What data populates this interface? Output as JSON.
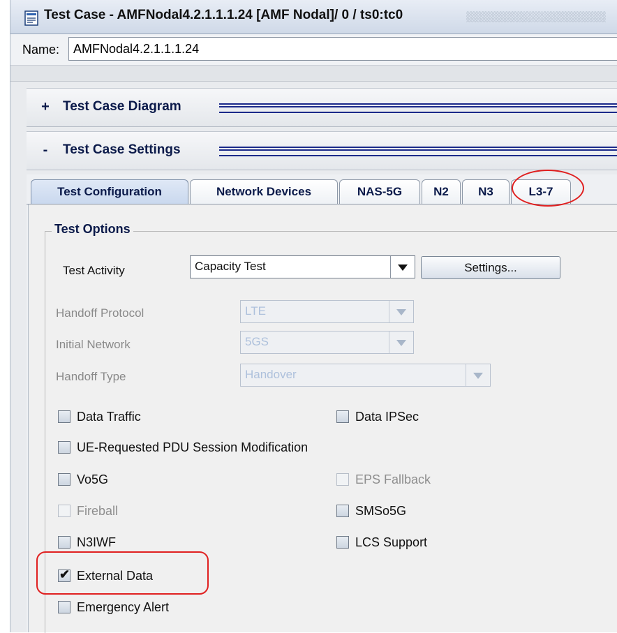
{
  "window": {
    "title": "Test Case - AMFNodal4.2.1.1.1.24 [AMF Nodal]/ 0 / ts0:tc0",
    "icon": "test-case-document-icon"
  },
  "name_field": {
    "label": "Name:",
    "value": "AMFNodal4.2.1.1.1.24"
  },
  "sections": [
    {
      "toggle": "+",
      "title": "Test Case Diagram"
    },
    {
      "toggle": "-",
      "title": "Test Case Settings"
    }
  ],
  "tabs": [
    {
      "label": "Test Configuration",
      "active": true
    },
    {
      "label": "Network Devices"
    },
    {
      "label": "NAS-5G"
    },
    {
      "label": "N2"
    },
    {
      "label": "N3"
    },
    {
      "label": "L3-7",
      "highlighted": true
    }
  ],
  "test_options": {
    "title": "Test Options",
    "test_activity": {
      "label": "Test Activity",
      "value": "Capacity Test",
      "settings_button": "Settings..."
    },
    "handoff_protocol": {
      "label": "Handoff Protocol",
      "value": "LTE",
      "disabled": true
    },
    "initial_network": {
      "label": "Initial Network",
      "value": "5GS",
      "disabled": true
    },
    "handoff_type": {
      "label": "Handoff Type",
      "value": "Handover",
      "disabled": true
    },
    "checkboxes": [
      {
        "label": "Data Traffic",
        "checked": false,
        "disabled": false
      },
      {
        "label": "Data IPSec",
        "checked": false,
        "disabled": false
      },
      {
        "label": "UE-Requested PDU Session Modification",
        "checked": false,
        "disabled": false
      },
      {
        "label": "Vo5G",
        "checked": false,
        "disabled": false
      },
      {
        "label": "EPS Fallback",
        "checked": false,
        "disabled": true
      },
      {
        "label": "Fireball",
        "checked": false,
        "disabled": true
      },
      {
        "label": "SMSo5G",
        "checked": false,
        "disabled": false
      },
      {
        "label": "N3IWF",
        "checked": false,
        "disabled": false
      },
      {
        "label": "LCS Support",
        "checked": false,
        "disabled": false
      },
      {
        "label": "External Data",
        "checked": true,
        "disabled": false,
        "highlighted": true
      },
      {
        "label": "Emergency Alert",
        "checked": false,
        "disabled": false
      }
    ]
  },
  "colors": {
    "section_title": "#0b1a4a",
    "highlight": "#e02020"
  }
}
